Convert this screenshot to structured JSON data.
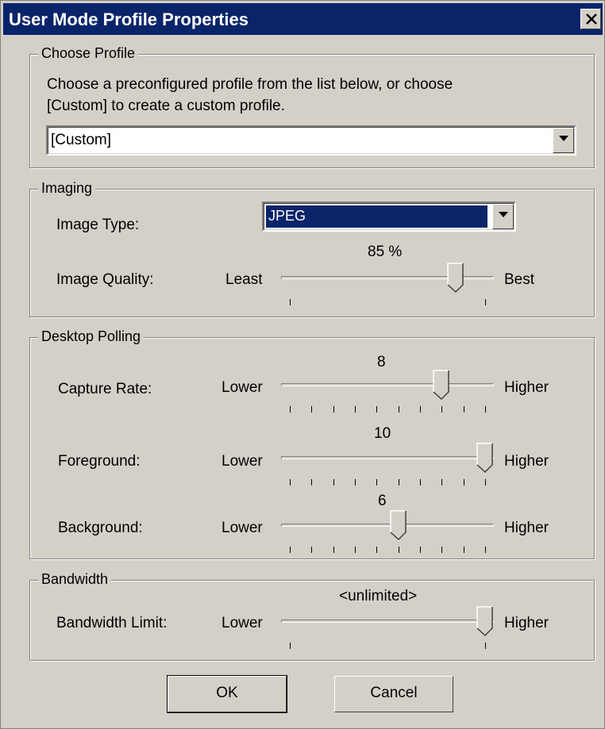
{
  "window": {
    "title": "User Mode Profile Properties",
    "close_glyph": "✕"
  },
  "choose_profile": {
    "group_label": "Choose Profile",
    "description_line1": "Choose a preconfigured profile from the list below, or choose",
    "description_line2": "[Custom] to create a custom profile.",
    "selected": "[Custom]"
  },
  "imaging": {
    "group_label": "Imaging",
    "image_type_label": "Image Type:",
    "image_type_value": "JPEG",
    "quality_label": "Image Quality:",
    "quality_value": "85 %",
    "quality_fraction": 0.85,
    "min_label": "Least",
    "max_label": "Best"
  },
  "desktop_polling": {
    "group_label": "Desktop Polling",
    "sliders": [
      {
        "label": "Capture Rate:",
        "value_text": "8",
        "value": 8,
        "min": 1,
        "max": 10,
        "min_label": "Lower",
        "max_label": "Higher"
      },
      {
        "label": "Foreground:",
        "value_text": "10",
        "value": 10,
        "min": 1,
        "max": 10,
        "min_label": "Lower",
        "max_label": "Higher"
      },
      {
        "label": "Background:",
        "value_text": "6",
        "value": 6,
        "min": 1,
        "max": 10,
        "min_label": "Lower",
        "max_label": "Higher"
      }
    ]
  },
  "bandwidth": {
    "group_label": "Bandwidth",
    "label": "Bandwidth Limit:",
    "value_text": "<unlimited>",
    "value_fraction": 1.0,
    "min_label": "Lower",
    "max_label": "Higher"
  },
  "buttons": {
    "ok": "OK",
    "cancel": "Cancel"
  },
  "colors": {
    "face": "#d4d0c8",
    "titlebar": "#0a246a",
    "selection": "#0a246a"
  }
}
